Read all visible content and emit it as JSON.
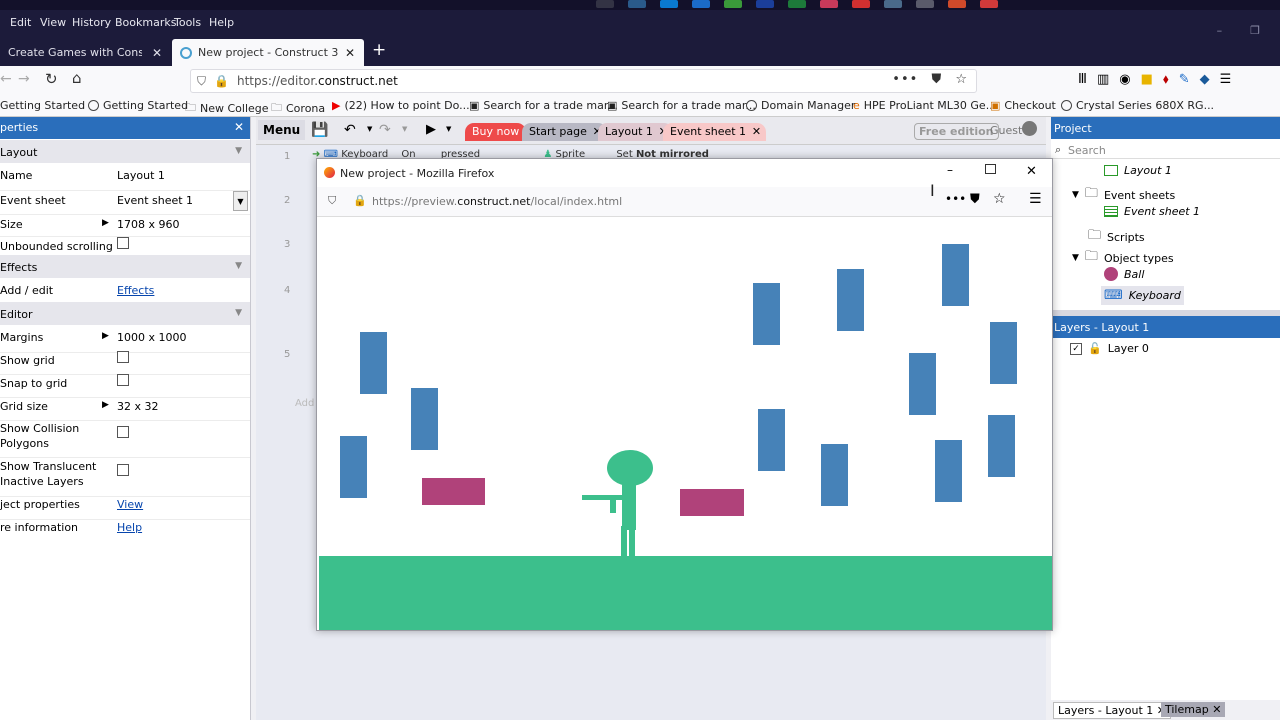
{
  "menubar": {
    "items": [
      "Edit",
      "View",
      "History",
      "Bookmarks",
      "Tools",
      "Help"
    ]
  },
  "tabs": [
    {
      "title": "Create Games with Construct 3"
    },
    {
      "title": "New project - Construct 3"
    }
  ],
  "url": {
    "prefix": "https://editor.",
    "domain": "construct.net"
  },
  "bookmarks": [
    "Getting Started",
    "Getting Started",
    "New College",
    "Corona",
    "(22) How to point Do...",
    "Search for a trade mar...",
    "Search for a trade mar...",
    "Domain Manager",
    "HPE ProLiant ML30 Ge...",
    "Checkout",
    "Crystal Series 680X RG..."
  ],
  "properties": {
    "title": "perties",
    "sections": {
      "layout": "Layout",
      "effects": "Effects",
      "editor": "Editor"
    },
    "name": {
      "label": "Name",
      "value": "Layout 1"
    },
    "event_sheet": {
      "label": "Event sheet",
      "value": "Event sheet 1"
    },
    "size": {
      "label": "Size",
      "value": "1708 x 960"
    },
    "unbounded": {
      "label": "Unbounded scrolling"
    },
    "add_edit": {
      "label": "Add / edit",
      "value": "Effects"
    },
    "margins": {
      "label": "Margins",
      "value": "1000 x 1000"
    },
    "show_grid": {
      "label": "Show grid"
    },
    "snap_grid": {
      "label": "Snap to grid"
    },
    "grid_size": {
      "label": "Grid size",
      "value": "32 x 32"
    },
    "collision": {
      "label1": "Show Collision",
      "label2": "Polygons"
    },
    "translucent": {
      "label1": "Show Translucent",
      "label2": "Inactive Layers"
    },
    "object_props": {
      "label": "ject properties",
      "value": "View"
    },
    "more_info": {
      "label": "re information",
      "value": "Help"
    }
  },
  "toolbar": {
    "menu": "Menu",
    "tabs": [
      "Buy now",
      "Start page",
      "Layout 1",
      "Event sheet 1"
    ],
    "free_edition": "Free edition",
    "guest": "Guest"
  },
  "eventsheet": {
    "rows": [
      "1",
      "2",
      "3",
      "4",
      "5"
    ],
    "row1": {
      "keyboard": "Keyboard",
      "on": "On",
      "pressed": "pressed",
      "sprite": "Sprite",
      "set": "Set",
      "mirrored": "Not mirrored"
    },
    "add": "Add"
  },
  "project": {
    "title": "Project",
    "search_placeholder": "Search",
    "items": {
      "layout1": "Layout 1",
      "event_sheets": "Event sheets",
      "event_sheet1": "Event sheet 1",
      "scripts": "Scripts",
      "object_types": "Object types",
      "ball": "Ball",
      "keyboard": "Keyboard"
    }
  },
  "layers": {
    "title": "Layers - Layout 1",
    "layer0": "Layer 0"
  },
  "bottom_tabs": [
    "Layers - Layout 1",
    "Tilemap"
  ],
  "preview": {
    "title": "New project - Mozilla Firefox",
    "url_prefix": "https://preview.",
    "url_domain": "construct.net",
    "url_path": "/local/index.html"
  },
  "colors": {
    "accent": "#2a6ebb",
    "block": "#4682b8",
    "pink": "#b0427a",
    "ground": "#3cbf8c"
  }
}
